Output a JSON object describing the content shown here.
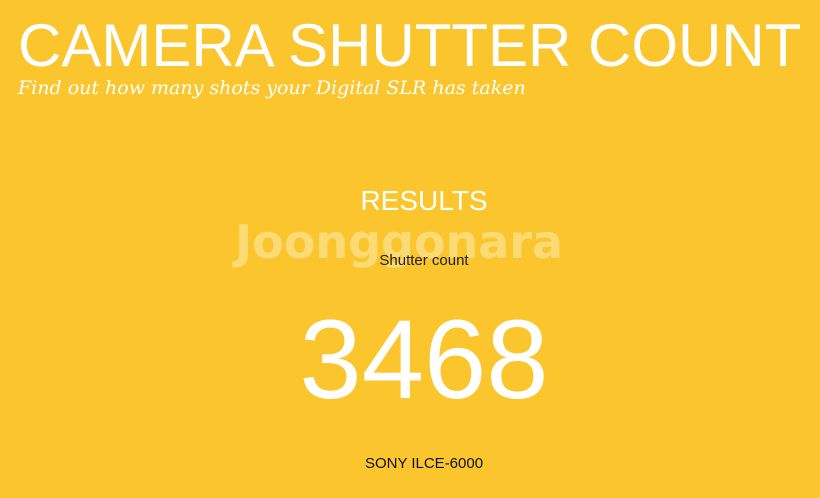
{
  "header": {
    "title": "CAMERA SHUTTER COUNT",
    "tagline": "Find out how many shots your Digital SLR has taken"
  },
  "results": {
    "heading": "RESULTS",
    "watermark": "Joonggonara",
    "shutter_label": "Shutter count",
    "shutter_count": "3468",
    "camera_model": "SONY ILCE-6000"
  },
  "colors": {
    "background": "#FBC62D",
    "text_primary": "#FFFFFF",
    "text_dark": "#222222"
  }
}
